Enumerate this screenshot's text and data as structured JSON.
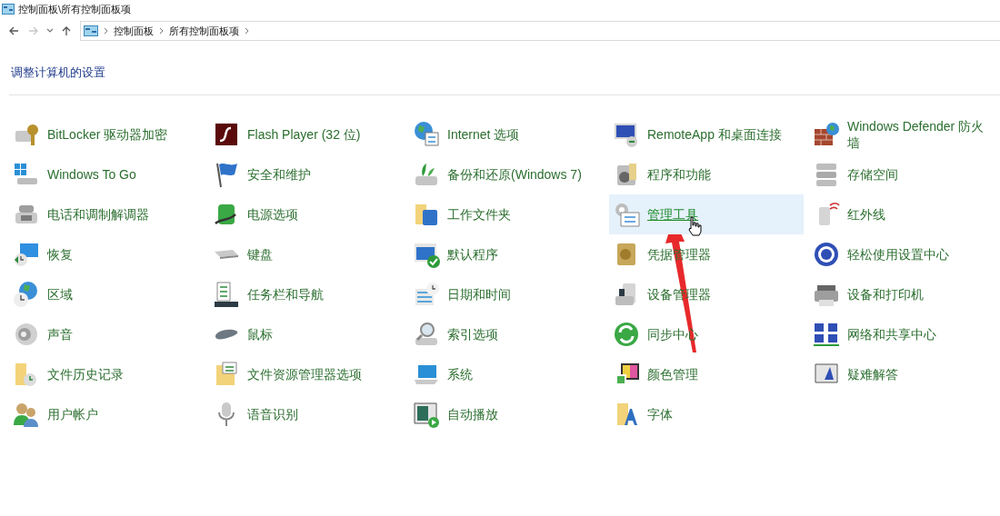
{
  "window": {
    "title": "控制面板\\所有控制面板项"
  },
  "address_bar": {
    "breadcrumbs": [
      "控制面板",
      "所有控制面板项"
    ]
  },
  "heading": "调整计算机的设置",
  "rows": [
    {
      "items": [
        {
          "label": "BitLocker 驱动器加密",
          "hovered": false
        },
        {
          "label": "Flash Player (32 位)",
          "hovered": false
        },
        {
          "label": "Internet 选项",
          "hovered": false
        },
        {
          "label": "RemoteApp 和桌面连接",
          "hovered": false
        },
        {
          "label": "Windows Defender 防火墙",
          "hovered": false
        }
      ]
    },
    {
      "items": [
        {
          "label": "Windows To Go",
          "hovered": false
        },
        {
          "label": "安全和维护",
          "hovered": false
        },
        {
          "label": "备份和还原(Windows 7)",
          "hovered": false
        },
        {
          "label": "程序和功能",
          "hovered": false
        },
        {
          "label": "存储空间",
          "hovered": false
        }
      ]
    },
    {
      "items": [
        {
          "label": "电话和调制解调器",
          "hovered": false
        },
        {
          "label": "电源选项",
          "hovered": false
        },
        {
          "label": "工作文件夹",
          "hovered": false
        },
        {
          "label": "管理工具",
          "hovered": true
        },
        {
          "label": "红外线",
          "hovered": false
        }
      ]
    },
    {
      "items": [
        {
          "label": "恢复",
          "hovered": false
        },
        {
          "label": "键盘",
          "hovered": false
        },
        {
          "label": "默认程序",
          "hovered": false
        },
        {
          "label": "凭据管理器",
          "hovered": false
        },
        {
          "label": "轻松使用设置中心",
          "hovered": false
        }
      ]
    },
    {
      "items": [
        {
          "label": "区域",
          "hovered": false
        },
        {
          "label": "任务栏和导航",
          "hovered": false
        },
        {
          "label": "日期和时间",
          "hovered": false
        },
        {
          "label": "设备管理器",
          "hovered": false
        },
        {
          "label": "设备和打印机",
          "hovered": false
        }
      ]
    },
    {
      "items": [
        {
          "label": "声音",
          "hovered": false
        },
        {
          "label": "鼠标",
          "hovered": false
        },
        {
          "label": "索引选项",
          "hovered": false
        },
        {
          "label": "同步中心",
          "hovered": false
        },
        {
          "label": "网络和共享中心",
          "hovered": false
        }
      ]
    },
    {
      "items": [
        {
          "label": "文件历史记录",
          "hovered": false
        },
        {
          "label": "文件资源管理器选项",
          "hovered": false
        },
        {
          "label": "系统",
          "hovered": false
        },
        {
          "label": "颜色管理",
          "hovered": false
        },
        {
          "label": "疑难解答",
          "hovered": false
        }
      ]
    },
    {
      "items": [
        {
          "label": "用户帐户",
          "hovered": false
        },
        {
          "label": "语音识别",
          "hovered": false
        },
        {
          "label": "自动播放",
          "hovered": false
        },
        {
          "label": "字体",
          "hovered": false
        }
      ]
    }
  ]
}
